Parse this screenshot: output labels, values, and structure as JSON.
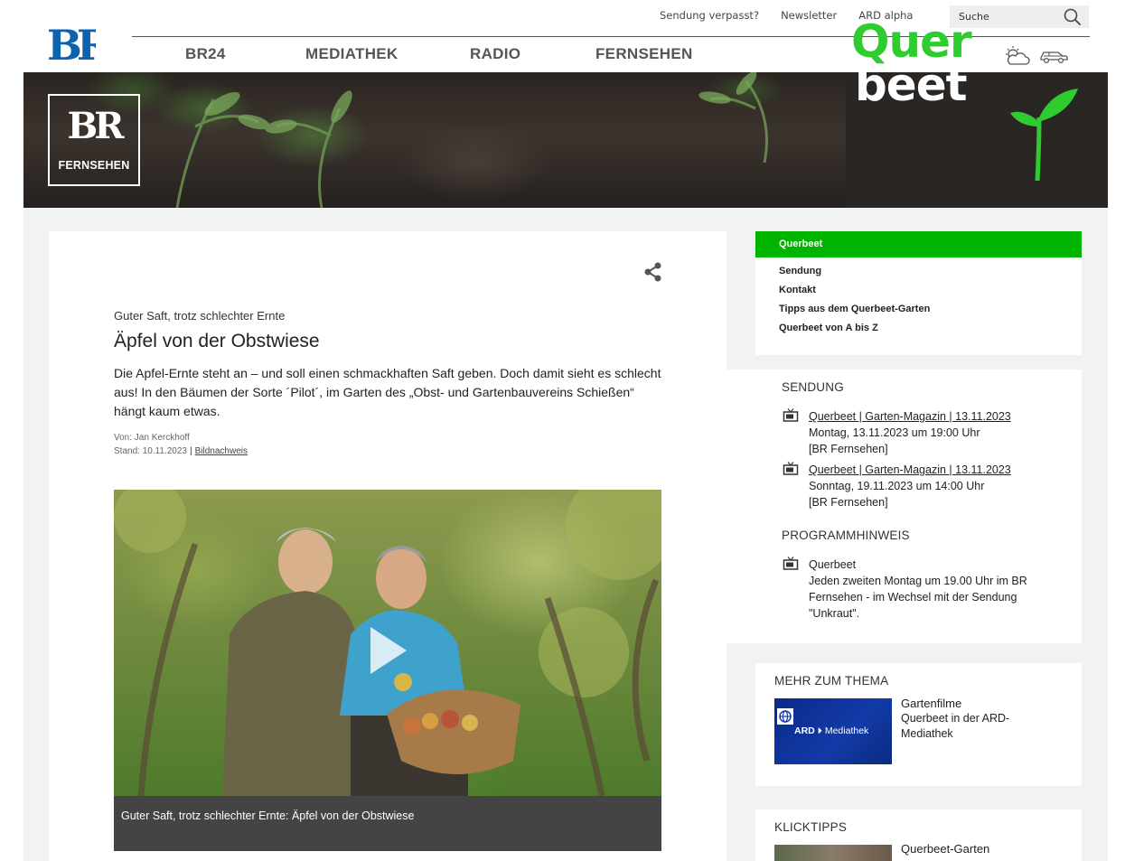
{
  "header": {
    "logo_text": "BR",
    "top_links": [
      "Sendung verpasst?",
      "Newsletter",
      "ARD alpha"
    ],
    "search_placeholder": "Suche",
    "main_nav": [
      "BR24",
      "MEDIATHEK",
      "RADIO",
      "FERNSEHEN"
    ]
  },
  "banner": {
    "br_logo": "BR",
    "br_sub": "FERNSEHEN",
    "show_title_line1": "Quer",
    "show_title_line2": "beet"
  },
  "article": {
    "kicker": "Guter Saft, trotz schlechter Ernte",
    "headline": "Äpfel von der Obstwiese",
    "teaser": "Die Apfel-Ernte steht an – und soll einen schmackhaften Saft geben. Doch damit sieht es schlecht aus! In den Bäumen der Sorte ´Pilot´, im Garten des „Obst- und Gartenbauvereins Schießen“ hängt kaum etwas.",
    "author": "Von: Jan Kerckhoff",
    "date": "Stand: 10.11.2023",
    "separator": "|",
    "credits_link": "Bildnachweis",
    "video_caption": "Guter Saft, trotz schlechter Ernte: Äpfel von der Obstwiese"
  },
  "sidebar": {
    "nav_header": "Querbeet",
    "nav_links": [
      "Sendung",
      "Kontakt",
      "Tipps aus dem Querbeet-Garten",
      "Querbeet von A bis Z"
    ],
    "sendung_header": "SENDUNG",
    "broadcasts": [
      {
        "title": "Querbeet | Garten-Magazin | 13.11.2023",
        "time": "Montag, 13.11.2023 um 19:00 Uhr",
        "channel": "[BR Fernsehen]"
      },
      {
        "title": "Querbeet | Garten-Magazin | 13.11.2023",
        "time": "Sonntag, 19.11.2023 um 14:00 Uhr",
        "channel": "[BR Fernsehen]"
      }
    ],
    "programm_header": "PROGRAMMHINWEIS",
    "programm": {
      "title": "Querbeet",
      "line1": "Jeden zweiten Montag um 19.00 Uhr im BR",
      "line2": "Fernsehen - im Wechsel mit der Sendung",
      "line3": "\"Unkraut\"."
    },
    "mehr_header": "MEHR ZUM THEMA",
    "mehr": {
      "thumb_brand": "ARD",
      "thumb_product": "Mediathek",
      "kicker": "Gartenfilme",
      "title_line1": "Querbeet in der ARD-",
      "title_line2": "Mediathek"
    },
    "klick_header": "KLICKTIPPS",
    "klick_title": "Querbeet-Garten"
  },
  "colors": {
    "br_blue": "#0b63b0",
    "querbeet_green": "#00b400",
    "caption_bg": "#444444"
  }
}
